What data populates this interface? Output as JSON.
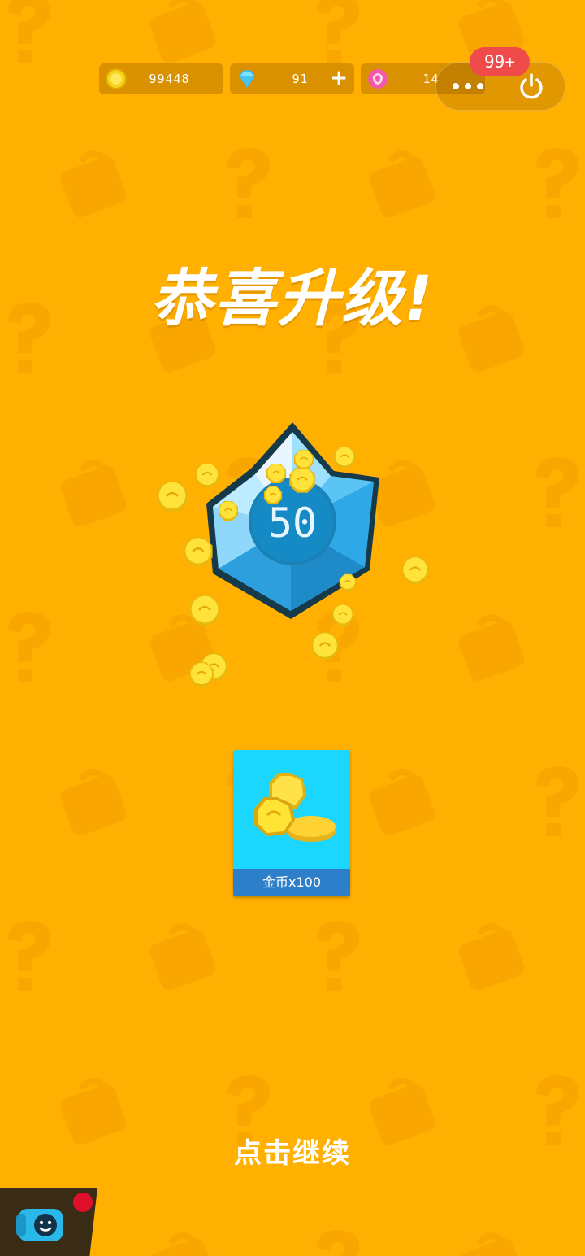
{
  "resources": {
    "coins": {
      "icon": "coin-icon",
      "value": "99448"
    },
    "diamonds": {
      "icon": "diamond-icon",
      "value": "91",
      "add_label": "+"
    },
    "flowers": {
      "icon": "flower-icon",
      "value": "14"
    }
  },
  "system": {
    "notification_badge": "99+",
    "more_icon": "more-dots-icon",
    "power_icon": "power-icon"
  },
  "title": "恭喜升级!",
  "level": "50",
  "reward": {
    "icon": "coin-pile-icon",
    "label": "金币x100"
  },
  "continue_label": "点击继续",
  "colors": {
    "background": "#FFB000",
    "reward_card": "#1BD6FF",
    "reward_label_bar": "#2E7FC9",
    "badge": "#F04A4A"
  }
}
